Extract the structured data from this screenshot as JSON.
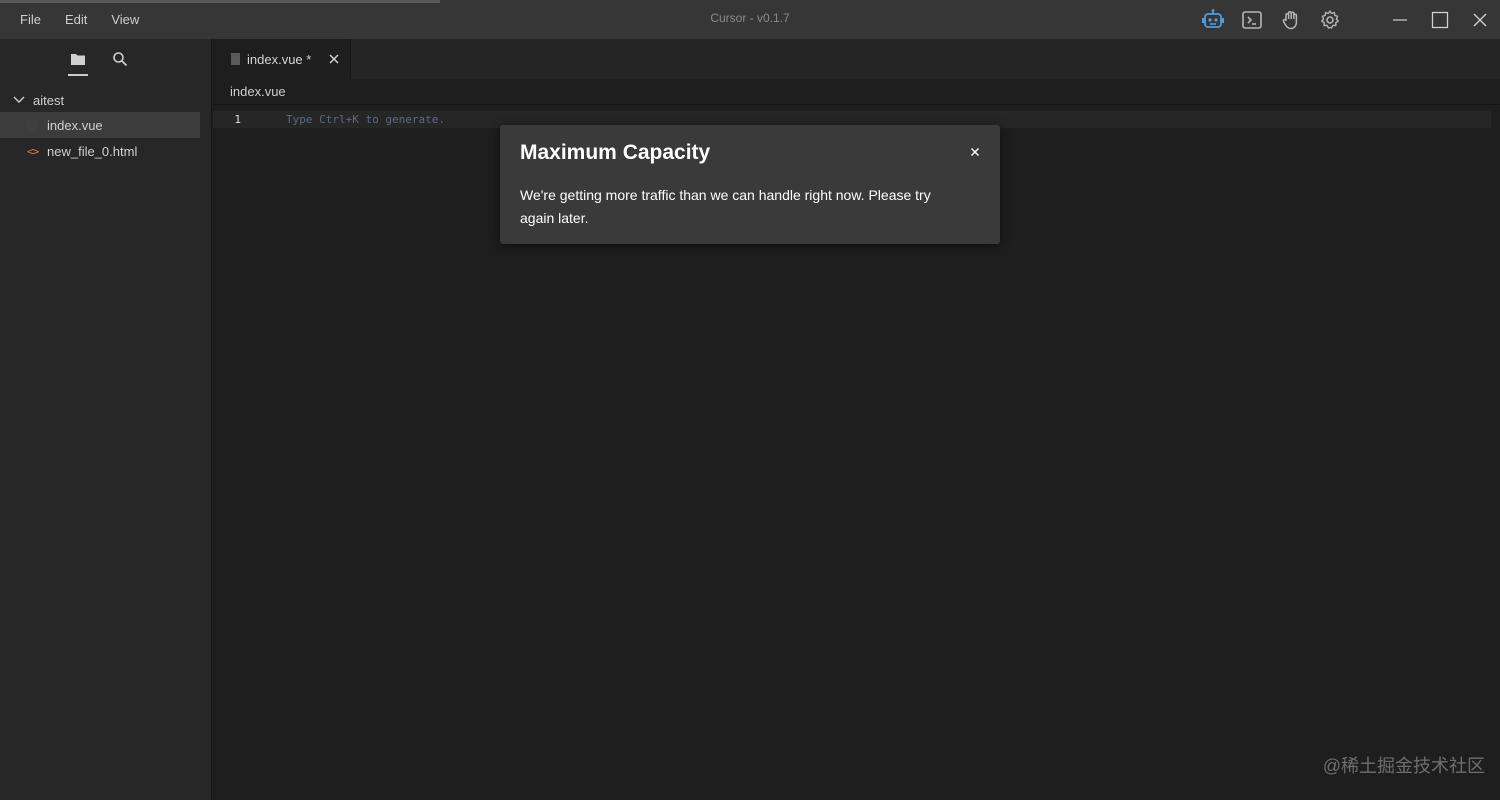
{
  "menu": {
    "file": "File",
    "edit": "Edit",
    "view": "View"
  },
  "window": {
    "title": "Cursor - v0.1.7"
  },
  "toolbar": {
    "icons": [
      "robot-icon",
      "terminal-icon",
      "hand-icon",
      "gear-icon"
    ],
    "accent_color": "#4d9de0"
  },
  "sidebar": {
    "tabs": [
      "folder-icon",
      "search-icon"
    ],
    "folder": "aitest",
    "files": [
      {
        "name": "index.vue",
        "icon": "file-icon",
        "selected": true
      },
      {
        "name": "new_file_0.html",
        "icon": "html-icon",
        "icon_text": "<>"
      }
    ]
  },
  "editor": {
    "tab_label": "index.vue *",
    "breadcrumb": "index.vue",
    "line_number": "1",
    "placeholder": "Type Ctrl+K to generate."
  },
  "modal": {
    "title": "Maximum Capacity",
    "body": "We're getting more traffic than we can handle right now. Please try again later.",
    "close": "×"
  },
  "watermark": "@稀土掘金技术社区"
}
